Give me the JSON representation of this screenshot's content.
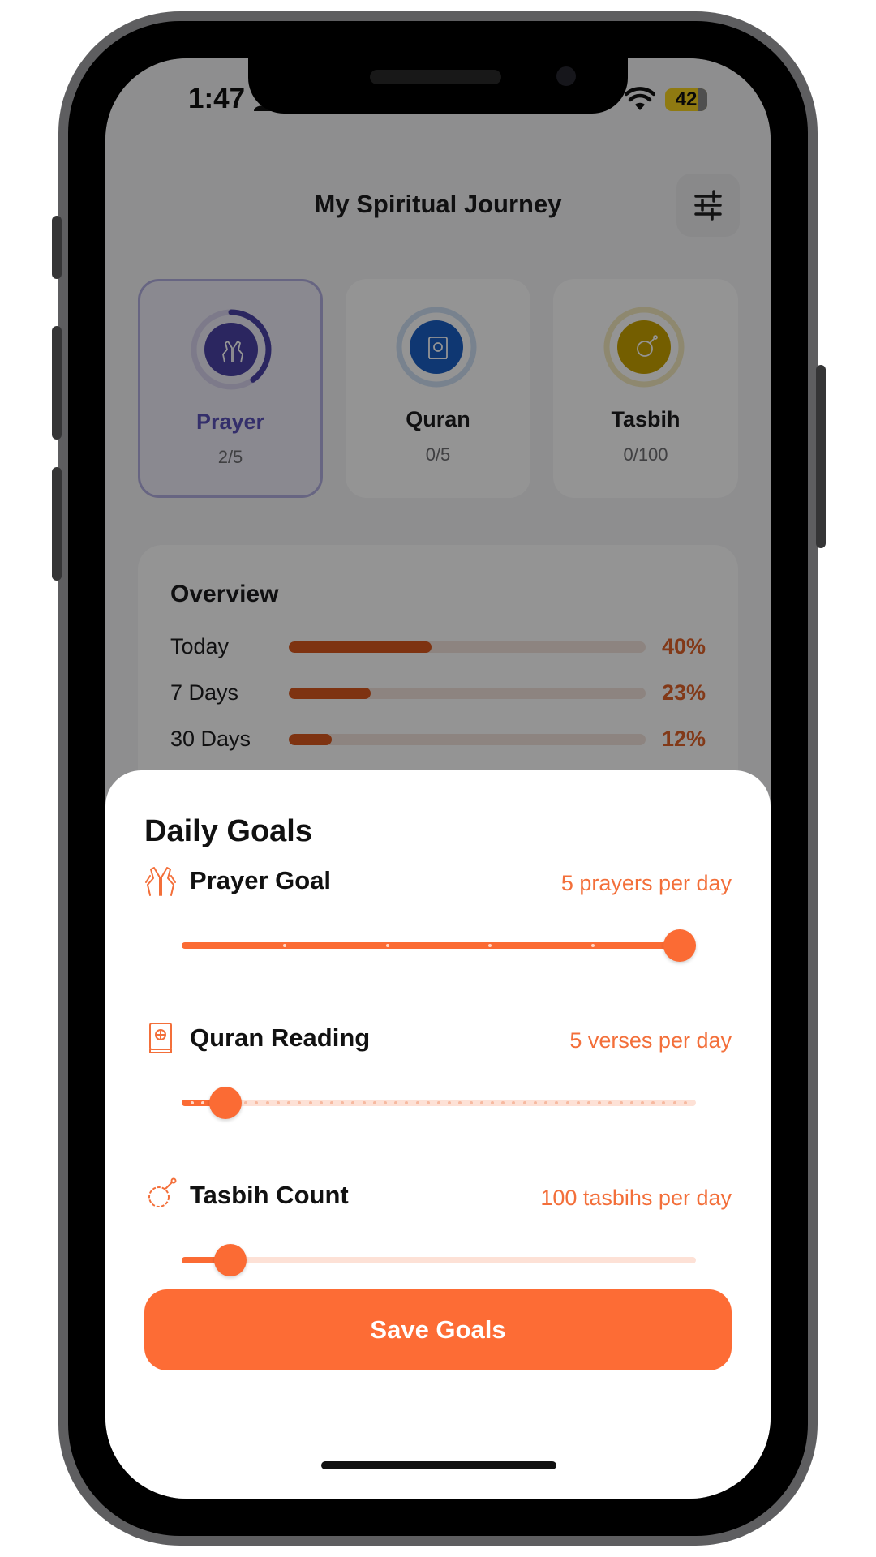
{
  "status_bar": {
    "time": "1:47",
    "battery": "42"
  },
  "header": {
    "title": "My Spiritual Journey",
    "filter_icon": "sliders-icon"
  },
  "categories": [
    {
      "label": "Prayer",
      "count": "2/5",
      "progress": 0.4,
      "color": "#4a42a6",
      "track": "#d7d3ee",
      "icon": "praying-hands-icon"
    },
    {
      "label": "Quran",
      "count": "0/5",
      "progress": 0.0,
      "color": "#1b5fc4",
      "track": "#cfe0f5",
      "icon": "quran-book-icon"
    },
    {
      "label": "Tasbih",
      "count": "0/100",
      "progress": 0.0,
      "color": "#c9a300",
      "track": "#f4ebbf",
      "icon": "tasbih-beads-icon"
    }
  ],
  "overview": {
    "title": "Overview",
    "rows": [
      {
        "label": "Today",
        "value": 40,
        "percent": "40%"
      },
      {
        "label": "7 Days",
        "value": 23,
        "percent": "23%"
      },
      {
        "label": "30 Days",
        "value": 12,
        "percent": "12%"
      }
    ]
  },
  "sheet": {
    "title": "Daily Goals",
    "goals": [
      {
        "label": "Prayer Goal",
        "value_text": "5 prayers per day",
        "icon": "praying-hands-icon",
        "fraction": 1.0,
        "steps": 5
      },
      {
        "label": "Quran Reading",
        "value_text": "5 verses per day",
        "icon": "quran-book-icon",
        "fraction": 0.085,
        "steps": 48
      },
      {
        "label": "Tasbih Count",
        "value_text": "100 tasbihs per day",
        "icon": "tasbih-beads-icon",
        "fraction": 0.095,
        "steps": 0
      }
    ],
    "save_label": "Save Goals"
  },
  "colors": {
    "accent": "#fd6c35",
    "overview_bar": "#d9581e",
    "prayer": "#4a42a6"
  }
}
